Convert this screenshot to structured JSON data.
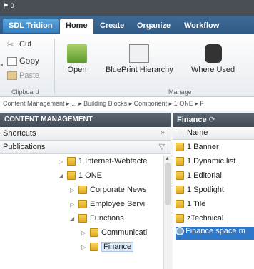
{
  "titlebar": {
    "text": "0"
  },
  "ribbon_tabs": {
    "brand": "SDL Tridion",
    "tabs": [
      "Home",
      "Create",
      "Organize",
      "Workflow"
    ]
  },
  "ribbon": {
    "clipboard": {
      "cut": "Cut",
      "copy": "Copy",
      "paste": "Paste",
      "group": "Clipboard"
    },
    "manage": {
      "open": "Open",
      "blueprint": "BluePrint Hierarchy",
      "where_used": "Where Used",
      "group": "Manage"
    }
  },
  "breadcrumb": "Content Management ▸ ... ▸ Building Blocks ▸ Component ▸ 1 ONE ▸ F",
  "left_panel": {
    "header": "CONTENT MANAGEMENT",
    "shortcuts": "Shortcuts",
    "publications": "Publications",
    "tree": [
      {
        "label": "1 Internet-Webfacte",
        "expanded": false
      },
      {
        "label": "1 ONE",
        "expanded": true
      },
      {
        "label": "Corporate News",
        "expanded": false
      },
      {
        "label": "Employee Servi",
        "expanded": false
      },
      {
        "label": "Functions",
        "expanded": true
      },
      {
        "label": "Communicati",
        "expanded": false
      },
      {
        "label": "Finance",
        "expanded": false,
        "selected": true
      }
    ]
  },
  "right_panel": {
    "header": "Finance",
    "column": "Name",
    "items": [
      "1 Banner",
      "1 Dynamic list",
      "1 Editorial",
      "1 Spotlight",
      "1 Tile",
      "zTechnical",
      "Finance space m"
    ]
  }
}
